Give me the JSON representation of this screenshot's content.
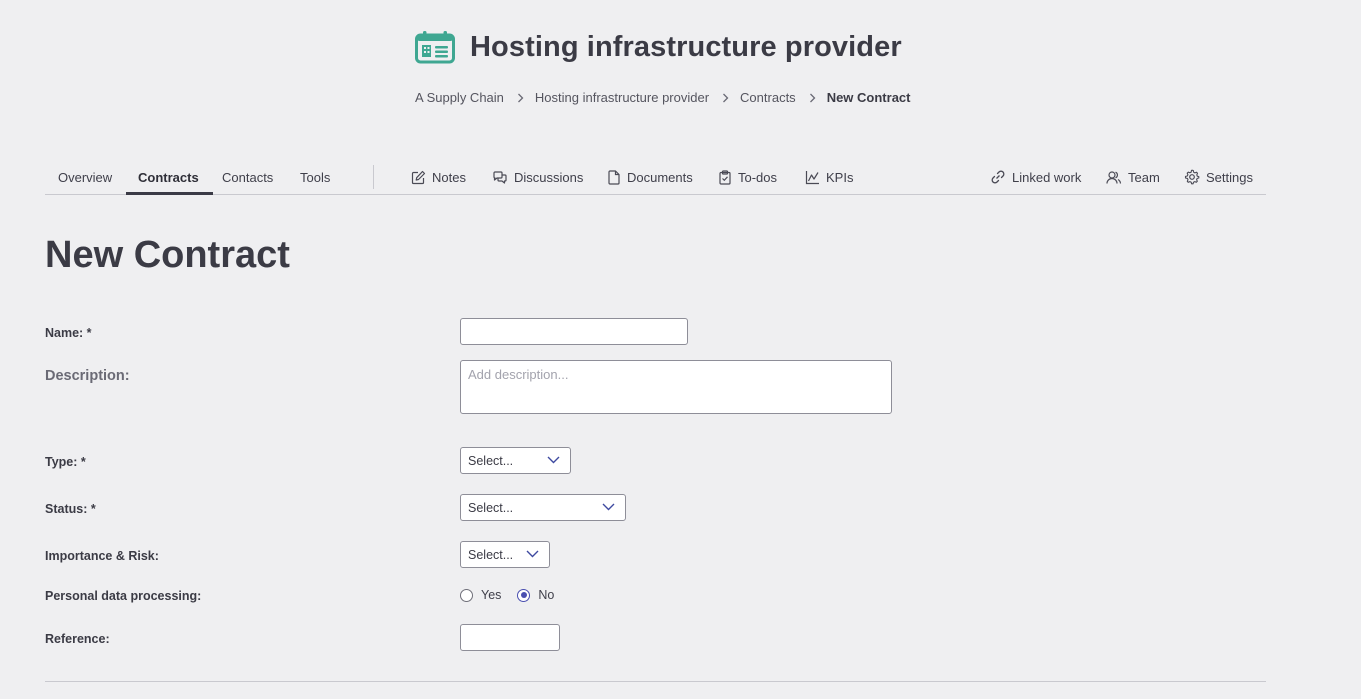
{
  "header": {
    "title": "Hosting infrastructure provider",
    "icon": "building-calendar-icon",
    "accent_color": "#3fa792"
  },
  "breadcrumb": {
    "items": [
      "A Supply Chain",
      "Hosting infrastructure provider",
      "Contracts"
    ],
    "current": "New Contract"
  },
  "tabs": {
    "overview": "Overview",
    "contracts": "Contracts",
    "contacts": "Contacts",
    "tools": "Tools",
    "notes": "Notes",
    "discussions": "Discussions",
    "documents": "Documents",
    "todos": "To-dos",
    "kpis": "KPIs",
    "linked_work": "Linked work",
    "team": "Team",
    "settings": "Settings",
    "active": "Contracts"
  },
  "form": {
    "title": "New Contract",
    "name_label": "Name: *",
    "name_value": "",
    "description_label": "Description:",
    "description_placeholder": "Add description...",
    "type_label": "Type: *",
    "type_value": "Select...",
    "status_label": "Status: *",
    "status_value": "Select...",
    "importance_label": "Importance & Risk:",
    "importance_value": "Select...",
    "personal_data_label": "Personal data processing:",
    "personal_data_options": [
      "Yes",
      "No"
    ],
    "personal_data_selected": "No",
    "reference_label": "Reference:",
    "reference_value": ""
  }
}
